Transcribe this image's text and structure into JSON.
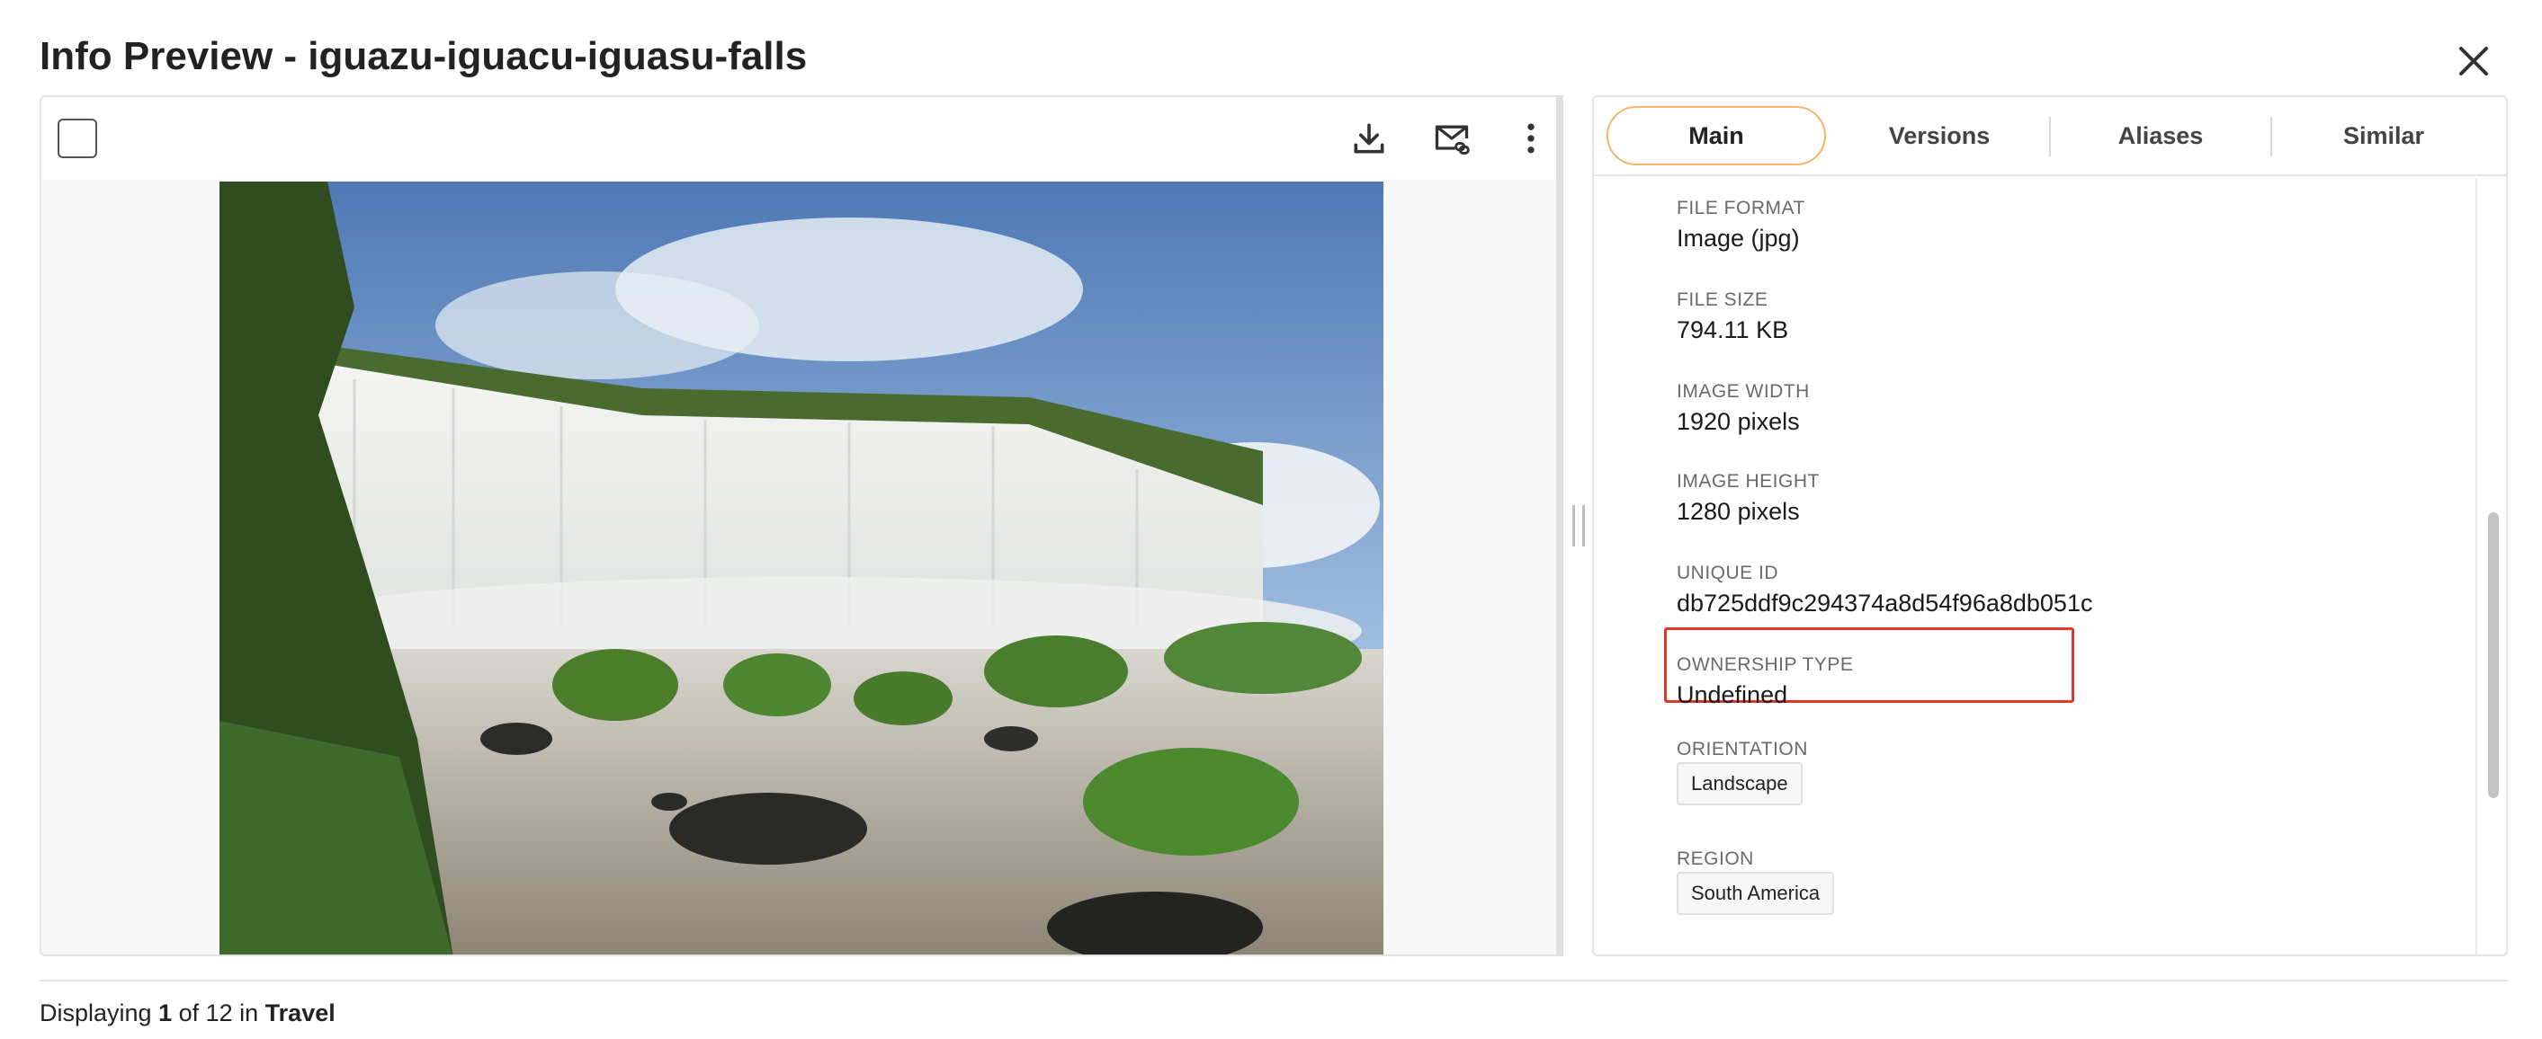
{
  "header": {
    "title": "Info Preview - iguazu-iguacu-iguasu-falls"
  },
  "toolbar": {
    "download_icon": "download-icon",
    "share_icon": "email-link-icon",
    "more_icon": "more-vertical-icon"
  },
  "tabs": [
    {
      "label": "Main"
    },
    {
      "label": "Versions"
    },
    {
      "label": "Aliases"
    },
    {
      "label": "Similar"
    }
  ],
  "info": {
    "file_format": {
      "label": "FILE FORMAT",
      "value": "Image (jpg)"
    },
    "file_size": {
      "label": "FILE SIZE",
      "value": "794.11 KB"
    },
    "image_width": {
      "label": "IMAGE WIDTH",
      "value": "1920 pixels"
    },
    "image_height": {
      "label": "IMAGE HEIGHT",
      "value": "1280 pixels"
    },
    "unique_id": {
      "label": "UNIQUE ID",
      "value": "db725ddf9c294374a8d54f96a8db051c"
    },
    "ownership_type": {
      "label": "OWNERSHIP TYPE",
      "value": "Undefined"
    },
    "orientation": {
      "label": "ORIENTATION",
      "value": "Landscape"
    },
    "region": {
      "label": "REGION",
      "value": "South America"
    }
  },
  "footer": {
    "prefix": "Displaying ",
    "current": "1",
    "middle": " of 12 in ",
    "collection": "Travel"
  },
  "colors": {
    "active_tab_border": "#f2b66a",
    "highlight_border": "#e0392b"
  }
}
